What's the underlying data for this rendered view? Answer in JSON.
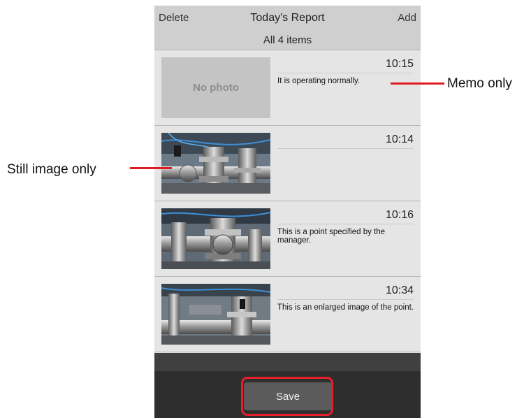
{
  "header": {
    "delete_label": "Delete",
    "title": "Today's Report",
    "add_label": "Add",
    "count": "All 4 items"
  },
  "items": [
    {
      "time": "10:15",
      "memo": "It is operating normally.",
      "photo": "No photo"
    },
    {
      "time": "10:14",
      "memo": "",
      "photo": "valve-equipment-image"
    },
    {
      "time": "10:16",
      "memo": "This is a point specified by the manager.",
      "photo": "valve-equipment-image"
    },
    {
      "time": "10:34",
      "memo": "This is an enlarged image of the point.",
      "photo": "valve-equipment-image"
    }
  ],
  "footer": {
    "save_label": "Save"
  },
  "annotations": {
    "memo_only": "Memo only",
    "still_image_only": "Still image only"
  },
  "colors": {
    "highlight": "#e5202b",
    "header_bg": "#cfcfcf",
    "list_bg": "#e5e5e5",
    "footer_bg": "#2e2e2e"
  }
}
